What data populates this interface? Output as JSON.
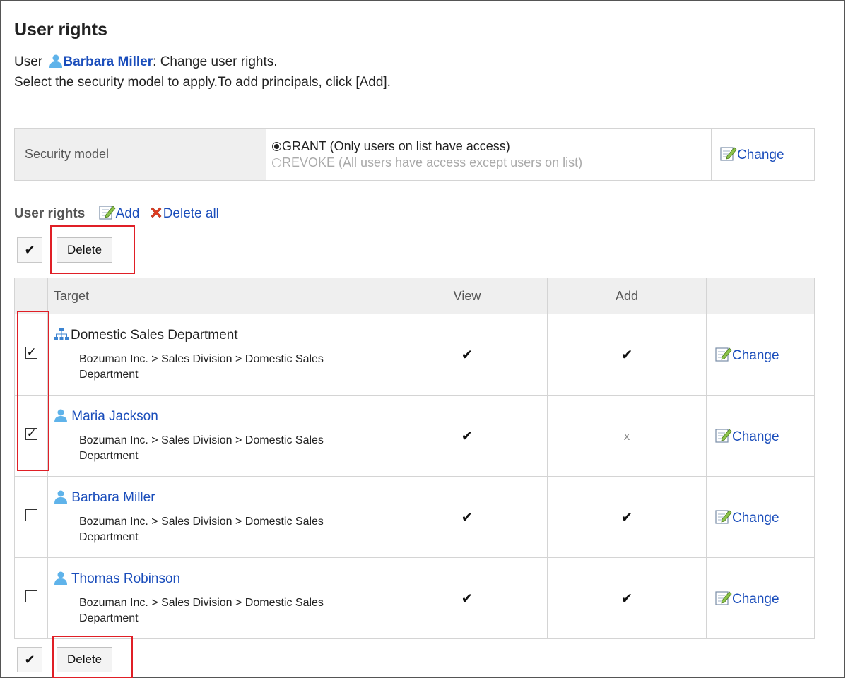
{
  "page": {
    "title": "User rights",
    "intro_prefix": "User",
    "intro_user": "Barbara Miller",
    "intro_suffix": ": Change user rights.",
    "intro_line2": "Select the security model to apply.To add principals, click [Add]."
  },
  "security_model": {
    "label": "Security model",
    "options": [
      {
        "label": "GRANT (Only users on list have access)",
        "selected": true
      },
      {
        "label": "REVOKE (All users have access except users on list)",
        "selected": false
      }
    ],
    "change_label": "Change"
  },
  "user_rights": {
    "title": "User rights",
    "add_label": "Add",
    "delete_all_label": "Delete all",
    "toolbar_check": "✔",
    "delete_label": "Delete",
    "columns": [
      "Target",
      "View",
      "Add",
      ""
    ],
    "rows": [
      {
        "type": "organization",
        "name": "Domestic Sales Department",
        "path": "Bozuman Inc. > Sales Division > Domestic Sales Department",
        "checked": true,
        "view": "✔",
        "add": "✔",
        "action": "Change"
      },
      {
        "type": "user",
        "name": "Maria Jackson",
        "path": "Bozuman Inc. > Sales Division > Domestic Sales Department",
        "checked": true,
        "view": "✔",
        "add": "x",
        "action": "Change"
      },
      {
        "type": "user",
        "name": "Barbara Miller",
        "path": "Bozuman Inc. > Sales Division > Domestic Sales Department",
        "checked": false,
        "view": "✔",
        "add": "✔",
        "action": "Change"
      },
      {
        "type": "user",
        "name": "Thomas Robinson",
        "path": "Bozuman Inc. > Sales Division > Domestic Sales Department",
        "checked": false,
        "view": "✔",
        "add": "✔",
        "action": "Change"
      }
    ]
  },
  "colors": {
    "link": "#1a4dbb",
    "highlight": "#e01f26",
    "header_bg": "#efefef"
  }
}
